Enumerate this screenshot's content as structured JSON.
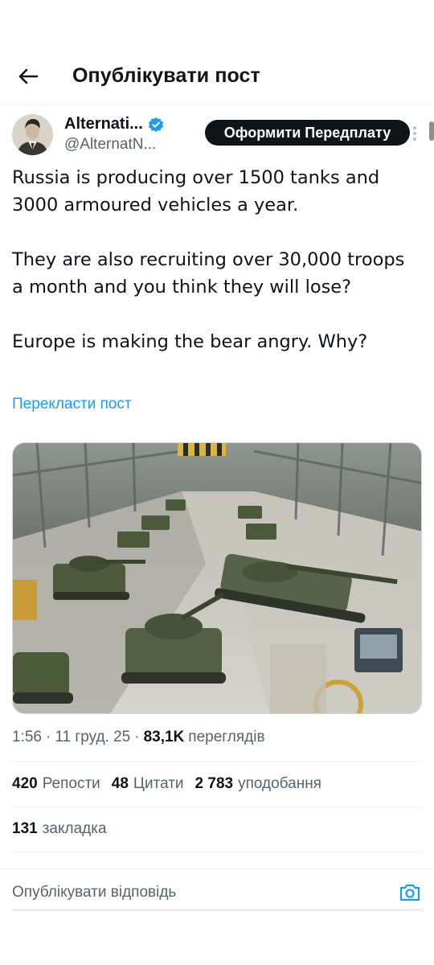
{
  "header": {
    "title": "Опублікувати пост",
    "back_icon": "arrow-left-icon"
  },
  "author": {
    "name": "Alternati...",
    "handle": "@AlternatN...",
    "verified_icon": "verified-badge-icon",
    "subscribe_label": "Оформити Передплату",
    "more_icon": "more-vertical-icon"
  },
  "post": {
    "paragraphs": [
      "Russia is producing over 1500 tanks and 3000 armoured vehicles a year.",
      "They are also recruiting over 30,000 troops a month and you think they will lose?",
      "Europe is making the bear angry. Why?"
    ],
    "translate_label": "Перекласти пост"
  },
  "meta": {
    "time": "1:56",
    "date": "11 груд. 25",
    "views_count": "83,1K",
    "views_label": "переглядів",
    "separator": "·"
  },
  "stats": {
    "reposts_count": "420",
    "reposts_label": "Репости",
    "quotes_count": "48",
    "quotes_label": "Цитати",
    "likes_count": "2 783",
    "likes_label": "уподобання",
    "bookmarks_count": "131",
    "bookmarks_label": "закладка"
  },
  "reply": {
    "placeholder": "Опублікувати відповідь",
    "camera_icon": "camera-icon"
  },
  "colors": {
    "accent": "#1d9bf0",
    "text": "#0f1419",
    "secondary": "#536471",
    "border": "#eff3f4"
  }
}
